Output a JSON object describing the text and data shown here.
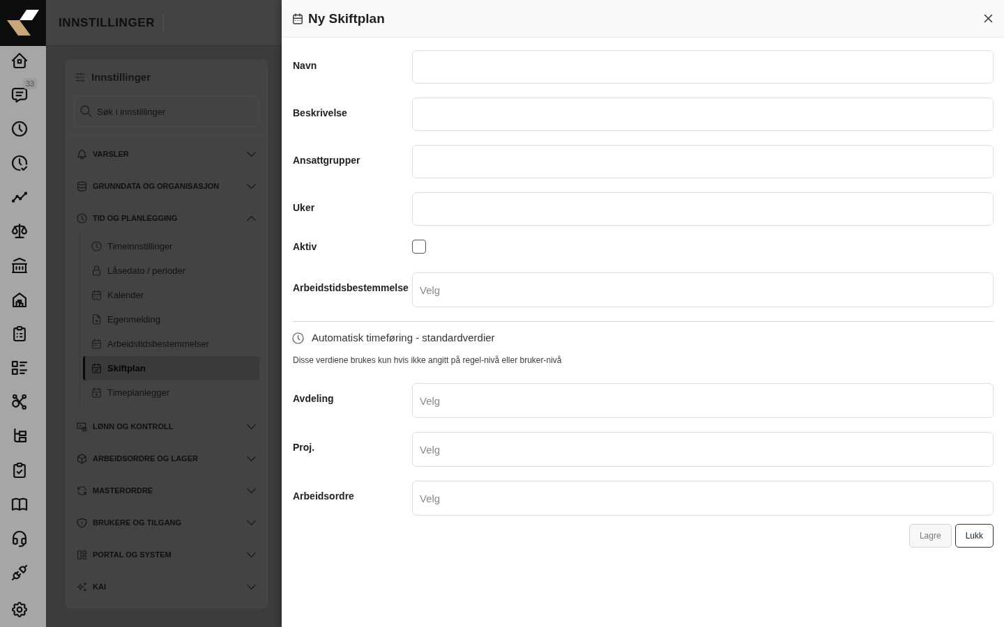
{
  "rail": {
    "items": [
      {
        "kind": "home"
      },
      {
        "kind": "chat",
        "badge": "33"
      },
      {
        "kind": "clock"
      },
      {
        "kind": "clock-check"
      },
      {
        "kind": "trend"
      },
      {
        "kind": "scale"
      },
      {
        "kind": "bank"
      },
      {
        "kind": "building"
      },
      {
        "kind": "clipboard"
      },
      {
        "kind": "list"
      },
      {
        "kind": "nodes"
      },
      {
        "kind": "tree"
      },
      {
        "kind": "clipboard-check"
      },
      {
        "kind": "book"
      },
      {
        "kind": "headset"
      },
      {
        "kind": "plug"
      }
    ],
    "footer_items": [
      {
        "kind": "settings"
      }
    ]
  },
  "page_header": {
    "title": "INNSTILLINGER"
  },
  "settings_panel": {
    "title": "Innstillinger",
    "search": {
      "placeholder": "Søk i innstillinger"
    },
    "sections": [
      {
        "label": "VARSLER",
        "kind": "bell",
        "expanded": false
      },
      {
        "label": "GRUNNDATA OG ORGANISASJON",
        "kind": "database",
        "expanded": false
      },
      {
        "label": "TID OG PLANLEGGING",
        "kind": "clock",
        "expanded": true,
        "children": [
          {
            "label": "Timeinnstillinger",
            "kind": "clock",
            "selected": false
          },
          {
            "label": "Låsedato / perioder",
            "kind": "lock",
            "selected": false
          },
          {
            "label": "Kalender",
            "kind": "calendar-grid",
            "selected": false
          },
          {
            "label": "Egenmelding",
            "kind": "document",
            "selected": false
          },
          {
            "label": "Arbeidstidsbestemmelser",
            "kind": "calendar-event",
            "selected": false
          },
          {
            "label": "Skiftplan",
            "kind": "calendar-check",
            "selected": true
          },
          {
            "label": "Timeplanlegger",
            "kind": "calendar-plus",
            "selected": false
          }
        ]
      },
      {
        "label": "LØNN OG KONTROLL",
        "kind": "cash",
        "expanded": false
      },
      {
        "label": "ARBEIDSORDRE OG LAGER",
        "kind": "box",
        "expanded": false
      },
      {
        "label": "MASTERORDRE",
        "kind": "refresh",
        "expanded": false
      },
      {
        "label": "BRUKERE OG TILGANG",
        "kind": "shield",
        "expanded": false
      },
      {
        "label": "PORTAL OG SYSTEM",
        "kind": "layout",
        "expanded": false
      },
      {
        "label": "KAI",
        "kind": "sparkles",
        "expanded": false
      }
    ]
  },
  "drawer": {
    "title": "Ny Skiftplan",
    "fields": [
      {
        "label": "Navn",
        "kind": "text"
      },
      {
        "label": "Beskrivelse",
        "kind": "text"
      },
      {
        "label": "Ansattgrupper",
        "kind": "text"
      },
      {
        "label": "Uker",
        "kind": "text"
      },
      {
        "label": "Aktiv",
        "kind": "checkbox",
        "checked": false
      },
      {
        "label": "Arbeidstidsbestemmelse",
        "kind": "select",
        "placeholder": "Velg"
      }
    ],
    "section": {
      "title": "Automatisk timeføring - standardverdier",
      "note": "Disse verdiene brukes kun hvis ikke angitt på regel-nivå eller bruker-nivå",
      "fields": [
        {
          "label": "Avdeling",
          "kind": "select",
          "placeholder": "Velg"
        },
        {
          "label": "Proj.",
          "kind": "select",
          "placeholder": "Velg"
        },
        {
          "label": "Arbeidsordre",
          "kind": "select",
          "placeholder": "Velg"
        }
      ]
    },
    "buttons": [
      {
        "label": "Lagre",
        "disabled": true
      },
      {
        "label": "Lukk",
        "disabled": false
      }
    ]
  }
}
